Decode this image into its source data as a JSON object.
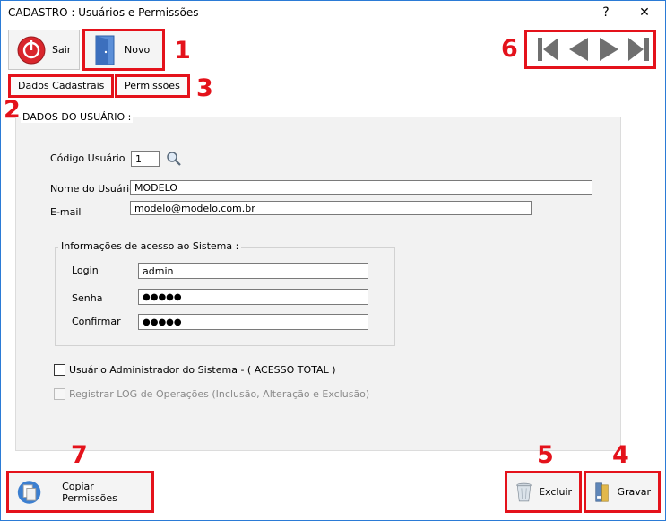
{
  "window": {
    "title": "CADASTRO : Usuários e Permissões",
    "help": "?",
    "close": "✕"
  },
  "toolbar": {
    "sair": "Sair",
    "novo": "Novo"
  },
  "tabs": {
    "dados": "Dados Cadastrais",
    "permissoes": "Permissões"
  },
  "section": {
    "title": "DADOS DO USUÁRIO :"
  },
  "form": {
    "codigo_label": "Código Usuário",
    "codigo_value": "1",
    "nome_label": "Nome do Usuário",
    "nome_value": "MODELO",
    "email_label": "E-mail",
    "email_value": "modelo@modelo.com.br"
  },
  "access": {
    "title": "Informações de acesso ao Sistema :",
    "login_label": "Login",
    "login_value": "admin",
    "senha_label": "Senha",
    "senha_value": "●●●●●",
    "confirmar_label": "Confirmar",
    "confirmar_value": "●●●●●"
  },
  "checks": {
    "admin": "Usuário Administrador do Sistema - ( ACESSO TOTAL )",
    "log": "Registrar LOG de Operações (Inclusão, Alteração e Exclusão)"
  },
  "bottom": {
    "copiar": "Copiar Permissões",
    "excluir": "Excluir",
    "gravar": "Gravar"
  },
  "annotations": {
    "n1": "1",
    "n2": "2",
    "n3": "3",
    "n4": "4",
    "n5": "5",
    "n6": "6",
    "n7": "7"
  },
  "colors": {
    "highlight": "#e4121b",
    "accent": "#2b7bd6"
  }
}
